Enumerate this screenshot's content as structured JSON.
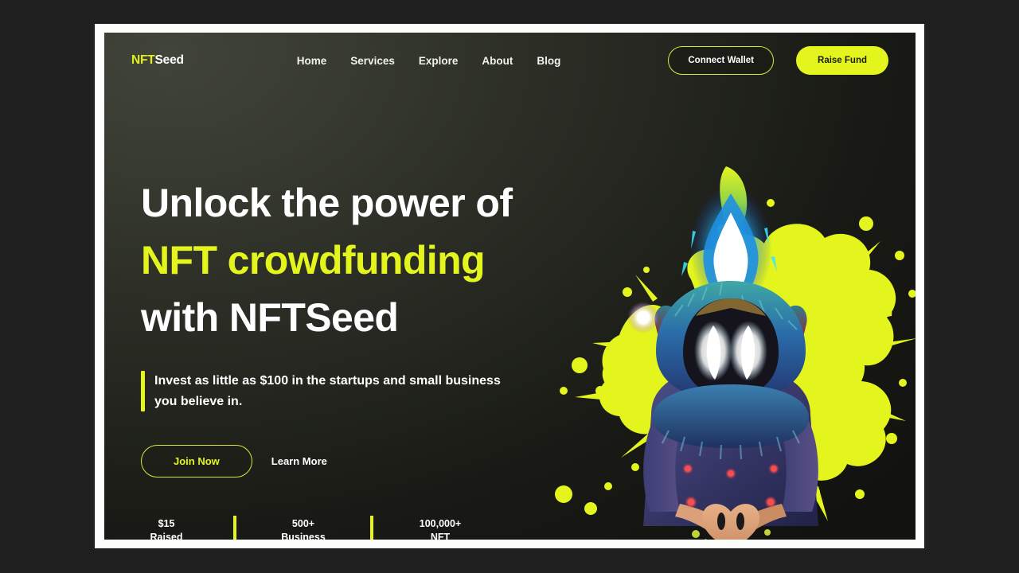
{
  "brand": {
    "logo_primary": "NFT",
    "logo_secondary": "Seed"
  },
  "nav": {
    "links": [
      {
        "label": "Home"
      },
      {
        "label": "Services"
      },
      {
        "label": "Explore"
      },
      {
        "label": "About"
      },
      {
        "label": "Blog"
      }
    ],
    "connect_wallet_label": "Connect Wallet",
    "raise_fund_label": "Raise Fund"
  },
  "hero": {
    "headline_line1": "Unlock the power of",
    "headline_line2": "NFT crowdfunding",
    "headline_line3": "with NFTSeed",
    "subheading": "Invest as little as $100 in the startups and small business you believe in.",
    "primary_cta": "Join Now",
    "secondary_cta": "Learn More",
    "stats": [
      {
        "value": "$15",
        "label": "Raised"
      },
      {
        "value": "500+",
        "label": "Business"
      },
      {
        "value": "100,000+",
        "label": "NFT"
      }
    ]
  },
  "colors": {
    "accent_yellow": "#e4f51e",
    "background_dark": "#262821",
    "frame_white": "#fdfdfb",
    "page_backdrop": "#1f1f1f",
    "text_white": "#ffffff"
  },
  "illustration": {
    "name": "nft-character-splatter",
    "description": "Hooded NFT character with glowing white eyes and blue flame over a yellow paint splatter"
  }
}
